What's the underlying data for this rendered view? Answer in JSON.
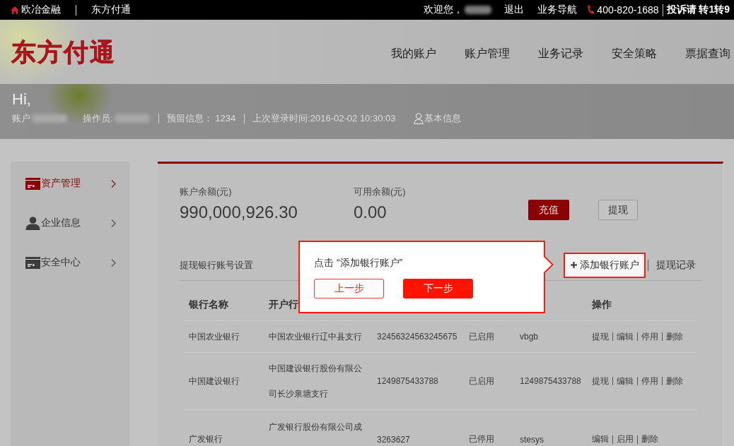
{
  "top_bar": {
    "brand": "欧冶金融",
    "site": "东方付通",
    "welcome": "欢迎您，",
    "user_masked": true,
    "links": [
      "退出",
      "业务导航"
    ],
    "phone": "400-820-1688",
    "complaint": "投诉请 转1转9"
  },
  "header": {
    "logo": "东方付通",
    "nav": [
      "我的账户",
      "账户管理",
      "业务记录",
      "安全策略",
      "票据查询"
    ]
  },
  "welcome_bar": {
    "greeting": "Hi,",
    "details": [
      {
        "label": "账户",
        "masked": true
      },
      {
        "label": "操作员:",
        "masked": true
      },
      {
        "label": "预留信息： 1234",
        "masked": false
      },
      {
        "label": "上次登录时间:2016-02-02 10:30:03",
        "masked": false
      }
    ],
    "profile_link": "基本信息"
  },
  "sidebar": {
    "items": [
      {
        "label": "资产管理",
        "selected": true
      },
      {
        "label": "企业信息",
        "selected": false
      },
      {
        "label": "安全中心",
        "selected": false
      }
    ]
  },
  "balances": [
    {
      "label": "账户余额(元)",
      "value": "990,000,926.30"
    },
    {
      "label": "可用余额(元)",
      "value": "0.00"
    }
  ],
  "balance_buttons": [
    {
      "label": "充值",
      "kind": "primary"
    },
    {
      "label": "提现",
      "kind": "secondary"
    }
  ],
  "bank_accounts": {
    "title": "提现银行账号设置",
    "add_button": {
      "label": "添加银行账户",
      "highlighted": true
    },
    "history_link": "提现记录",
    "table": {
      "headings": {
        "column_1": "银行名称",
        "column_2": "开户行",
        "column_6": "操作"
      },
      "rows": [
        {
          "cells": [
            "中国农业银行",
            "中国农业银行辽中县支行",
            "32456324563245675",
            "已启用",
            "vbgb"
          ],
          "actions": [
            "提现",
            "编辑",
            "停用",
            "删除"
          ]
        },
        {
          "cells": [
            "中国建设银行",
            "中国建设银行股份有限公司长沙泉塘支行",
            "1249875433788",
            "已启用",
            "1249875433788"
          ],
          "actions": [
            "提现",
            "编辑",
            "停用",
            "删除"
          ]
        },
        {
          "cells": [
            "广发银行",
            "广发银行股份有限公司成",
            "3263627",
            "已停用",
            "stesys"
          ],
          "actions": [
            "编辑",
            "启用",
            "删除"
          ]
        }
      ]
    }
  },
  "tour_popover": {
    "message": "点击 “添加银行账户”",
    "buttons": [
      {
        "label": "上一步",
        "kind": "secondary"
      },
      {
        "label": "下一步",
        "kind": "primary"
      }
    ]
  }
}
